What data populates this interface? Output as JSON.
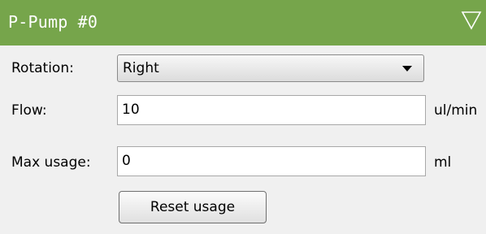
{
  "panel": {
    "title": "P-Pump #0",
    "toggle_icon": "collapse-triangle-icon"
  },
  "rotation": {
    "label": "Rotation:",
    "value": "Right"
  },
  "flow": {
    "label": "Flow:",
    "value": "10",
    "unit": "ul/min"
  },
  "max_usage": {
    "label": "Max usage:",
    "value": "0",
    "unit": "ml"
  },
  "reset_button": {
    "label": "Reset usage"
  },
  "colors": {
    "header_bg": "#76a54b",
    "panel_bg": "#f0f0f0"
  }
}
